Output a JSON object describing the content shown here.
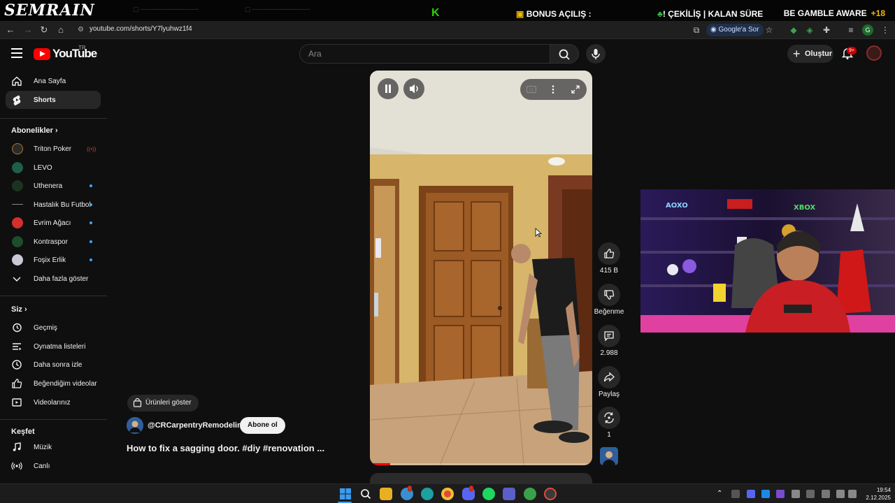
{
  "overlay": {
    "streamer_logo": "SEMRAIN",
    "bonus": "BONUS AÇILIŞ :",
    "cekilis": "! ÇEKİLİŞ | KALAN SÜRE",
    "gamble_aware": "BE GAMBLE AWARE",
    "age": "+18"
  },
  "browser": {
    "url": "youtube.com/shorts/Y7lyuhwz1f4",
    "ask_google": "Google'a Sor",
    "profile_initial": "G"
  },
  "header": {
    "country_code": "TR",
    "logo_text": "YouTube",
    "search_placeholder": "Ara",
    "create_label": "Oluştur",
    "notification_count": "9+"
  },
  "sidebar": {
    "main": [
      {
        "label": "Ana Sayfa"
      },
      {
        "label": "Shorts"
      }
    ],
    "subscriptions_title": "Abonelikler",
    "subscriptions": [
      {
        "label": "Triton Poker"
      },
      {
        "label": "LEVO"
      },
      {
        "label": "Uthenera"
      },
      {
        "label": "Hastalık Bu Futbol"
      },
      {
        "label": "Evrim Ağacı"
      },
      {
        "label": "Kontraspor"
      },
      {
        "label": "Foşix Erlik"
      }
    ],
    "show_more": "Daha fazla göster",
    "you_title": "Siz",
    "you": [
      {
        "label": "Geçmiş"
      },
      {
        "label": "Oynatma listeleri"
      },
      {
        "label": "Daha sonra izle"
      },
      {
        "label": "Beğendiğim videolar"
      },
      {
        "label": "Videolarınız"
      }
    ],
    "explore_title": "Keşfet",
    "explore": [
      {
        "label": "Müzik"
      },
      {
        "label": "Canlı"
      }
    ]
  },
  "short": {
    "products_label": "Ürünleri göster",
    "channel_handle": "@CRCarpentryRemodeling",
    "subscribe_label": "Abone ol",
    "title": "How to fix a sagging door. #diy #renovation ...",
    "progress_fraction": 0.09
  },
  "actions": {
    "like_count": "415 B",
    "dislike_label": "Beğenme",
    "comment_count": "2.988",
    "share_label": "Paylaş",
    "remix_count": "1"
  },
  "taskbar": {
    "time": "19:54",
    "date": "2.12.2025"
  },
  "colors": {
    "background": "#0f0f0f",
    "youtube_red": "#ff0000",
    "subscribe_bg": "#f1f1f1",
    "unread_dot": "#3ea6ff"
  }
}
